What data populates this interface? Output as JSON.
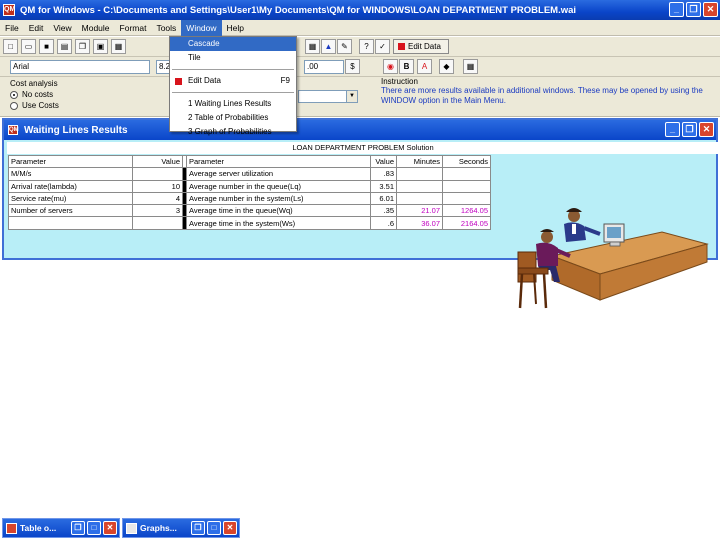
{
  "app": {
    "title": "QM for Windows - C:\\Documents and Settings\\User1\\My Documents\\QM for WINDOWS\\LOAN DEPARTMENT PROBLEM.wai",
    "icon_label": "QM"
  },
  "window_controls": {
    "minimize": "_",
    "restore": "❐",
    "close": "✕"
  },
  "menu": [
    "File",
    "Edit",
    "View",
    "Module",
    "Format",
    "Tools",
    "Window",
    "Help"
  ],
  "toolbar": {
    "font_name": "Arial",
    "font_size": "8.2",
    "zoom": ".00",
    "edit_data_label": "Edit Data"
  },
  "window_menu": {
    "items": [
      {
        "label": "Cascade",
        "highlighted": true
      },
      {
        "label": "Tile",
        "highlighted": false
      }
    ],
    "edit_data": {
      "label": "Edit Data",
      "shortcut": "F9"
    },
    "windows": [
      "1 Waiting Lines Results",
      "2 Table of Probabilities",
      "3 Graph of Probabilities"
    ]
  },
  "options": {
    "title": "Cost analysis",
    "radios": [
      {
        "label": "No costs",
        "checked": true
      },
      {
        "label": "Use Costs",
        "checked": false
      }
    ]
  },
  "instruction": {
    "title": "Instruction",
    "text": "There are more results available in additional windows. These may be opened by using the WINDOW option in the Main Menu."
  },
  "results": {
    "window_title": "Waiting Lines Results",
    "subheader": "LOAN DEPARTMENT PROBLEM Solution",
    "headers": [
      "Parameter",
      "Value",
      "Parameter",
      "Value",
      "Minutes",
      "Seconds"
    ],
    "rows": [
      [
        "M/M/s",
        "",
        "Average server utilization",
        ".83",
        "",
        ""
      ],
      [
        "Arrival rate(lambda)",
        "10",
        "Average number in the queue(Lq)",
        "3.51",
        "",
        ""
      ],
      [
        "Service rate(mu)",
        "4",
        "Average number in the system(Ls)",
        "6.01",
        "",
        ""
      ],
      [
        "Number of servers",
        "3",
        "Average time in the queue(Wq)",
        ".35",
        "21.07",
        "1264.05"
      ],
      [
        "",
        "",
        "Average time in the system(Ws)",
        ".6",
        "36.07",
        "2164.05"
      ]
    ]
  },
  "minimized": [
    {
      "title": "Table o..."
    },
    {
      "title": "Graphs..."
    }
  ],
  "colors": {
    "titlebar": "#0a45c9",
    "results_bg": "#b8eef7",
    "accent_pink": "#c000c0",
    "instruction_text": "#1a3ac0"
  }
}
